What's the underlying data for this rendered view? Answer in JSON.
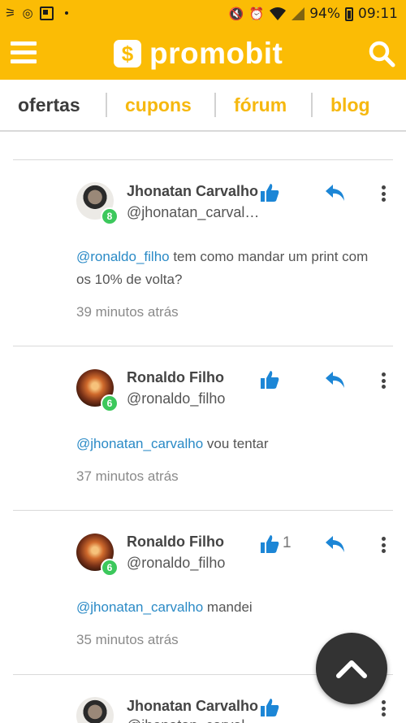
{
  "status_bar": {
    "battery": "94%",
    "time": "09:11"
  },
  "header": {
    "logo_symbol": "$",
    "logo_text": "promobit",
    "icons": [
      "menu-icon",
      "search-icon"
    ]
  },
  "tabs": [
    {
      "label": "ofertas",
      "active": true
    },
    {
      "label": "cupons",
      "active": false
    },
    {
      "label": "fórum",
      "active": false
    },
    {
      "label": "blog",
      "active": false
    }
  ],
  "comments": [
    {
      "name": "Jhonatan Carvalho",
      "handle": "@jhonatan_carval…",
      "level": "8",
      "mention": "@ronaldo_filho",
      "text": " tem como mandar um print com os 10% de volta?",
      "time": "39 minutos atrás",
      "likes": ""
    },
    {
      "name": "Ronaldo Filho",
      "handle": "@ronaldo_filho",
      "level": "6",
      "mention": "@jhonatan_carvalho",
      "text": " vou tentar",
      "time": "37 minutos atrás",
      "likes": ""
    },
    {
      "name": "Ronaldo Filho",
      "handle": "@ronaldo_filho",
      "level": "6",
      "mention": "@jhonatan_carvalho",
      "text": " mandei",
      "time": "35 minutos atrás",
      "likes": "1"
    },
    {
      "name": "Jhonatan Carvalho",
      "handle": "@jhonatan_carval…",
      "level": "",
      "likes": ""
    }
  ],
  "colors": {
    "brand": "#fbbc05",
    "tab_link": "#f6b80f",
    "mention": "#2a8ac6",
    "icon_blue": "#1c86d6",
    "level_badge": "#3cc85c",
    "fab": "#333333"
  },
  "fab": {
    "icon": "chevron-up-icon"
  }
}
